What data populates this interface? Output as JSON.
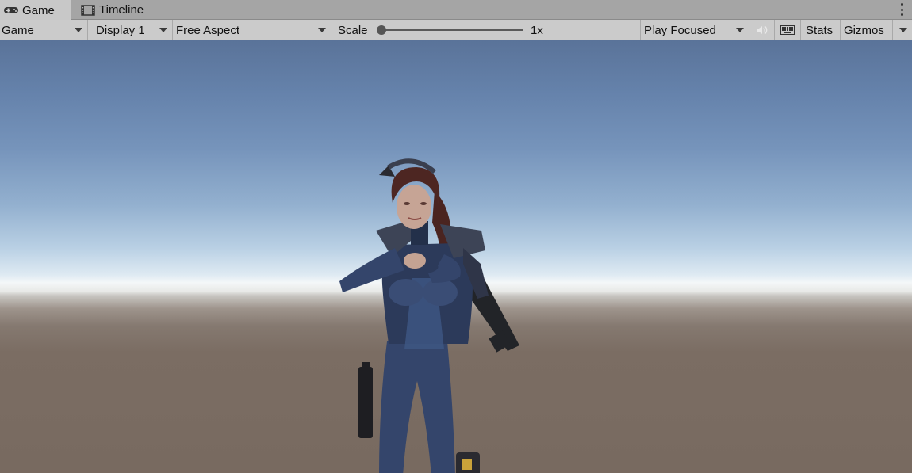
{
  "tabs": [
    {
      "label": "Game",
      "icon": "gamepad-icon",
      "active": true
    },
    {
      "label": "Timeline",
      "icon": "film-icon",
      "active": false
    }
  ],
  "toolbar": {
    "view_mode": "Game",
    "display": "Display 1",
    "aspect": "Free Aspect",
    "scale_label": "Scale",
    "scale_value": "1x",
    "play_mode": "Play Focused",
    "stats_label": "Stats",
    "gizmos_label": "Gizmos"
  },
  "icons": {
    "audio": "speaker-icon",
    "keyboard": "keyboard-icon",
    "more": "kebab-menu-icon"
  },
  "colors": {
    "toolbar_bg": "#cbcbcb",
    "tabbar_bg": "#a5a5a5",
    "sky_top": "#5a7399",
    "horizon": "#f4f7f8",
    "ground": "#786a60",
    "suit": "#2c3a5a"
  }
}
